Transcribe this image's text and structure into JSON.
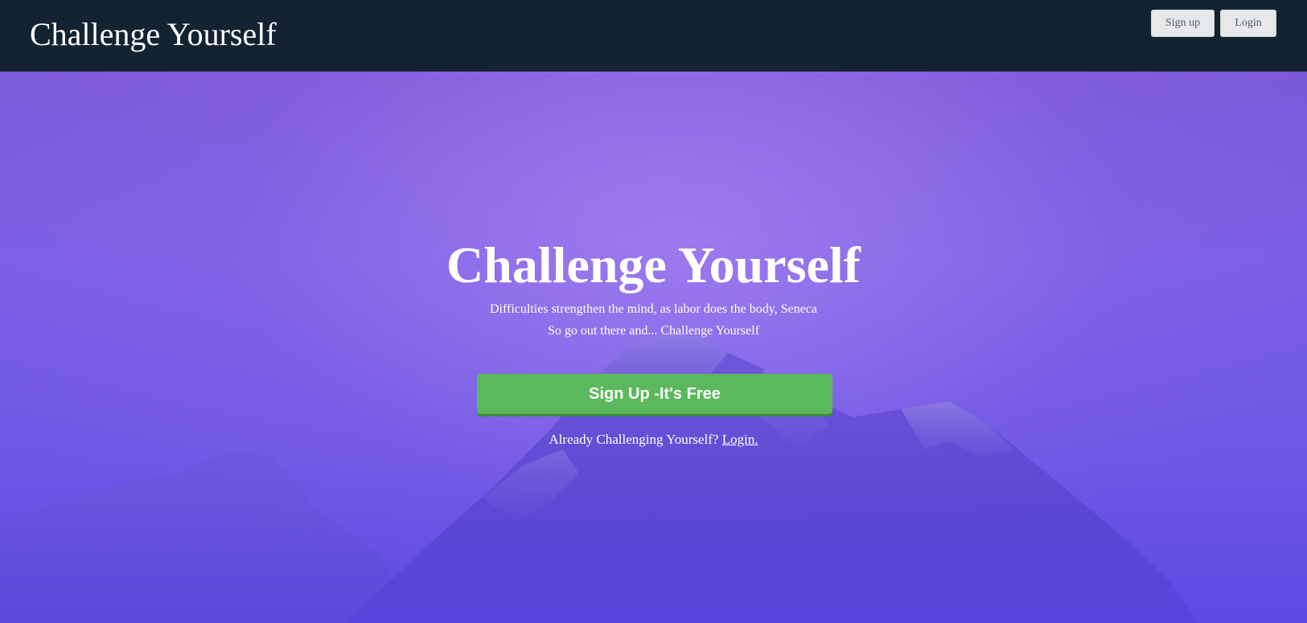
{
  "navbar": {
    "brand": "Challenge Yourself",
    "signup_label": "Sign up",
    "login_label": "Login",
    "background_color": "#142332"
  },
  "hero": {
    "title": "Challenge Yourself",
    "subtitle_line1": "Difficulties strengthen the mind, as labor does the body, Seneca",
    "subtitle_line2": "So go out there and... Challenge Yourself",
    "cta_label": "Sign Up -It's Free",
    "cta_color": "#5cb85c",
    "already_text": "Already Challenging Yourself?",
    "already_link": "Login.",
    "background_tint": "#6e57e6"
  }
}
